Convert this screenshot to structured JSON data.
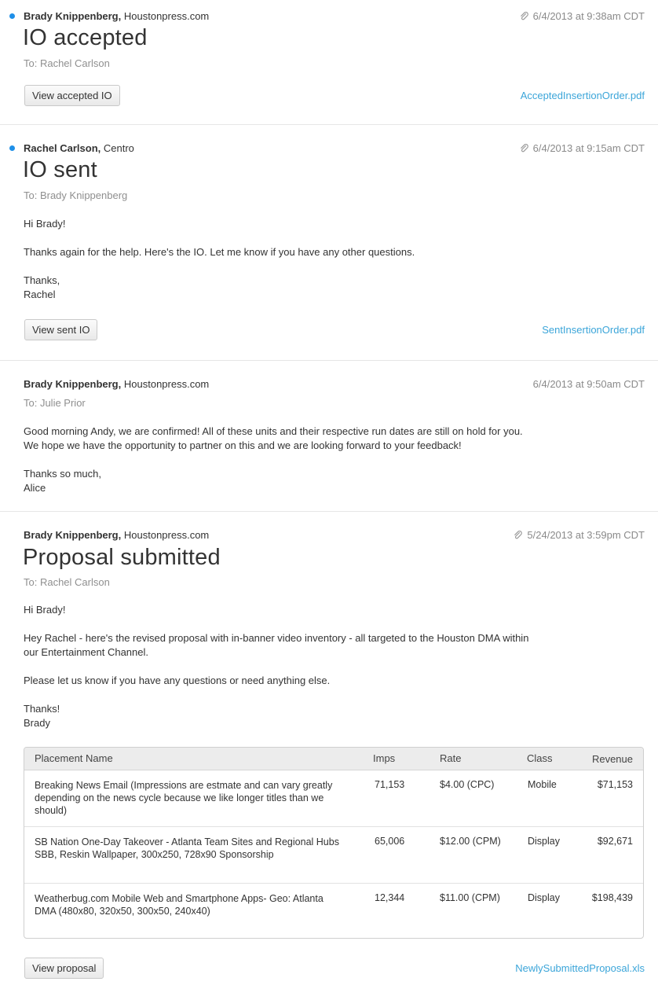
{
  "colors": {
    "unread_dot": "#1e8fe8",
    "link": "#3ba5d9",
    "muted": "#8a8a8a"
  },
  "messages": [
    {
      "sender": "Brady Knippenberg,",
      "org": "Houstonpress.com",
      "timestamp": "6/4/2013 at 9:38am CDT",
      "title": "IO accepted",
      "to": "To: Rachel Carlson",
      "button": "View accepted IO",
      "file": "AcceptedInsertionOrder.pdf"
    },
    {
      "sender": "Rachel Carlson,",
      "org": "Centro",
      "timestamp": "6/4/2013 at 9:15am CDT",
      "title": "IO sent",
      "to": "To: Brady Knippenberg",
      "body": [
        "Hi Brady!",
        "Thanks again for the help.  Here's the IO.  Let me know if you have any other questions.",
        "Thanks,",
        "Rachel"
      ],
      "button": "View sent IO",
      "file": "SentInsertionOrder.pdf"
    },
    {
      "sender": "Brady Knippenberg,",
      "org": "Houstonpress.com",
      "timestamp": "6/4/2013 at 9:50am CDT",
      "to": "To: Julie Prior",
      "body": [
        "Good morning Andy, we are confirmed! All of these units and their respective run dates are still on hold for you.",
        "We hope we have the opportunity to partner on this and we are looking forward to your feedback!",
        "Thanks so much,",
        "Alice"
      ]
    },
    {
      "sender": "Brady Knippenberg,",
      "org": "Houstonpress.com",
      "timestamp": "5/24/2013 at 3:59pm CDT",
      "title": "Proposal submitted",
      "to": "To: Rachel Carlson",
      "body": [
        "Hi Brady!",
        "Hey Rachel - here's the revised proposal with in-banner video inventory - all targeted to the Houston DMA within",
        "our Entertainment Channel.",
        "Please let us know if you have any questions or need anything else.",
        "Thanks!",
        "Brady"
      ],
      "button": "View proposal",
      "file": "NewlySubmittedProposal.xls"
    }
  ],
  "proposal_table": {
    "headers": {
      "name": "Placement Name",
      "imps": "Imps",
      "rate": "Rate",
      "class": "Class",
      "revenue": "Revenue"
    },
    "rows": [
      {
        "name": "Breaking News Email (Impressions are estmate and can vary greatly depending on the news cycle because we like longer titles than we should)",
        "imps": "71,153",
        "rate": "$4.00 (CPC)",
        "class": "Mobile",
        "revenue": "$71,153"
      },
      {
        "name": "SB Nation One-Day Takeover - Atlanta Team Sites and Regional Hubs SBB, Reskin Wallpaper, 300x250, 728x90 Sponsorship",
        "imps": "65,006",
        "rate": "$12.00 (CPM)",
        "class": "Display",
        "revenue": "$92,671"
      },
      {
        "name": "Weatherbug.com Mobile Web and Smartphone Apps- Geo: Atlanta DMA (480x80, 320x50, 300x50, 240x40)",
        "imps": "12,344",
        "rate": "$11.00 (CPM)",
        "class": "Display",
        "revenue": "$198,439"
      }
    ]
  }
}
